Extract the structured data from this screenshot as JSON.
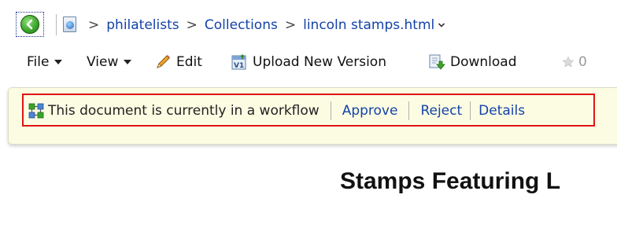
{
  "breadcrumb": {
    "separator": ">",
    "items": [
      "philatelists",
      "Collections"
    ],
    "current": "lincoln stamps.html"
  },
  "toolbar": {
    "file_label": "File",
    "view_label": "View",
    "edit_label": "Edit",
    "upload_label": "Upload New Version",
    "upload_icon_text": "V1",
    "download_label": "Download",
    "rating_count": "0"
  },
  "workflow": {
    "message": "This document is currently in a workflow",
    "approve_label": "Approve",
    "reject_label": "Reject",
    "details_label": "Details"
  },
  "page": {
    "heading": "Stamps Featuring L"
  },
  "icons": {
    "back": "back-arrow-icon",
    "site": "site-globe-icon",
    "edit": "pencil-icon",
    "upload": "upload-version-icon",
    "download": "download-icon",
    "rating": "star-icon",
    "workflow": "workflow-icon"
  },
  "colors": {
    "link": "#1443a8",
    "workflow_bar_bg": "#fcfce3",
    "highlight_border": "#e01414",
    "back_button_green": "#3aa52a"
  }
}
